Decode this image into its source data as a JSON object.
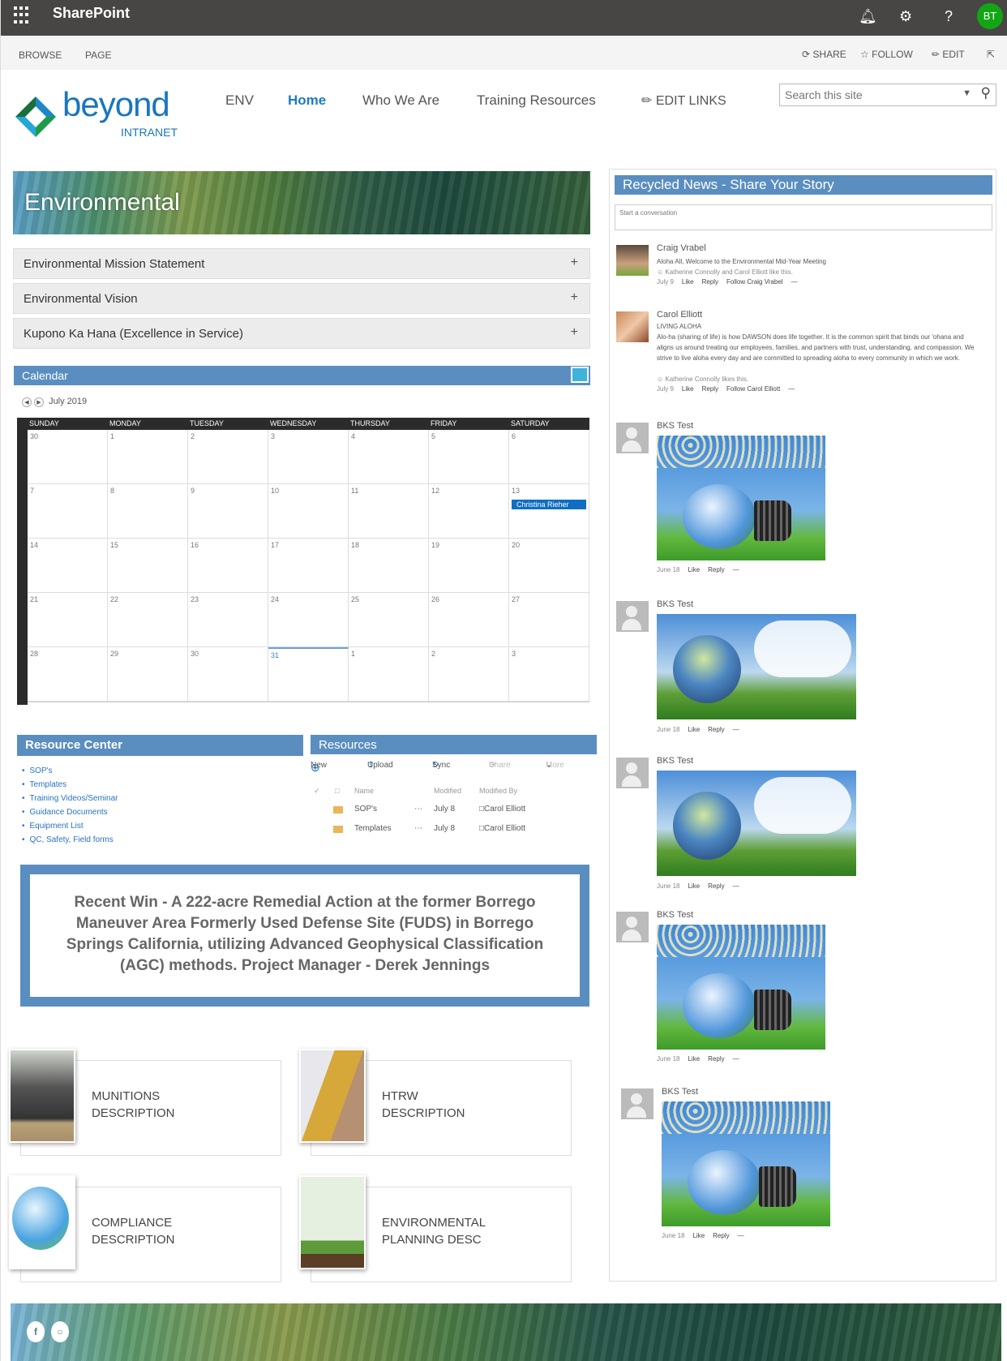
{
  "suite": {
    "brand": "SharePoint",
    "avatar_initials": "BT",
    "avatar_color": "#12a614"
  },
  "ribbon": {
    "tabs": [
      "BROWSE",
      "PAGE"
    ],
    "actions": {
      "share": "SHARE",
      "follow": "FOLLOW",
      "edit": "EDIT"
    }
  },
  "logo": {
    "word": "beyond",
    "sub": "INTRANET"
  },
  "nav": {
    "items": [
      "ENV",
      "Home",
      "Who We Are",
      "Training Resources"
    ],
    "active": "Home",
    "edit_links": "EDIT LINKS"
  },
  "search": {
    "placeholder": "Search this site"
  },
  "hero": {
    "title": "Environmental"
  },
  "accordion": [
    "Environmental Mission Statement",
    "Environmental Vision",
    "Kupono Ka Hana (Excellence in Service)"
  ],
  "calendar": {
    "title": "Calendar",
    "month": "July 2019",
    "days": [
      "SUNDAY",
      "MONDAY",
      "TUESDAY",
      "WEDNESDAY",
      "THURSDAY",
      "FRIDAY",
      "SATURDAY"
    ],
    "weeks": [
      [
        "30",
        "1",
        "2",
        "3",
        "4",
        "5",
        "6"
      ],
      [
        "7",
        "8",
        "9",
        "10",
        "11",
        "12",
        "13"
      ],
      [
        "14",
        "15",
        "16",
        "17",
        "18",
        "19",
        "20"
      ],
      [
        "21",
        "22",
        "23",
        "24",
        "25",
        "26",
        "27"
      ],
      [
        "28",
        "29",
        "30",
        "31",
        "1",
        "2",
        "3"
      ]
    ],
    "today": "31",
    "event": {
      "date": "13",
      "label": "Christina Rieher"
    }
  },
  "resource_center": {
    "title": "Resource Center",
    "links": [
      "SOP's",
      "Templates",
      "Training Videos/Seminar",
      "Guidance Documents",
      "Equipment List",
      "QC, Safety, Field forms"
    ]
  },
  "resources": {
    "title": "Resources",
    "toolbar": {
      "new": "New",
      "upload": "Upload",
      "sync": "Sync",
      "share": "Share",
      "more": "More"
    },
    "columns": {
      "name": "Name",
      "modified": "Modified",
      "modified_by": "Modified By"
    },
    "rows": [
      {
        "name": "SOP's",
        "modified": "July 8",
        "modified_by": "Carol Elliott"
      },
      {
        "name": "Templates",
        "modified": "July 8",
        "modified_by": "Carol Elliott"
      }
    ]
  },
  "recent_win": "Recent Win - A 222-acre Remedial Action at the former Borrego Maneuver Area Formerly Used Defense Site (FUDS) in Borrego Springs California, utilizing Advanced Geophysical Classification (AGC) methods. Project Manager - Derek Jennings",
  "tiles": [
    {
      "line1": "MUNITIONS",
      "line2": "DESCRIPTION"
    },
    {
      "line1": "HTRW",
      "line2": "DESCRIPTION"
    },
    {
      "line1": "COMPLIANCE",
      "line2": "DESCRIPTION"
    },
    {
      "line1": "ENVIRONMENTAL",
      "line2": "PLANNING DESC"
    }
  ],
  "feed": {
    "title": "Recycled News - Share Your Story",
    "placeholder": "Start a conversation",
    "posts": [
      {
        "author": "Craig Vrabel",
        "text": "Aloha All, Welcome to the Environmental Mid-Year Meeting",
        "likes": "Katherine Connolly and Carol Elliott like this.",
        "date": "July 9",
        "like": "Like",
        "reply": "Reply",
        "follow": "Follow Craig Vrabel",
        "more": "—"
      },
      {
        "author": "Carol Elliott",
        "subtitle": "LIVING ALOHA",
        "text": "Alo-ha (sharing of life) is how DAWSON does life together. It is the common spirit that binds our 'ohana and aligns us around treating our employees, families, and partners with trust, understanding, and compassion. We strive to live aloha every day and are committed to spreading aloha to every community in which we work.",
        "likes": "Katherine Connolly likes this.",
        "date": "July 9",
        "like": "Like",
        "reply": "Reply",
        "follow": "Follow Carol Elliott",
        "more": "—"
      },
      {
        "author": "BKS Test",
        "image": "lightbulb",
        "date": "June 18",
        "like": "Like",
        "reply": "Reply",
        "more": "—"
      },
      {
        "author": "BKS Test",
        "image": "earth",
        "date": "June 18",
        "like": "Like",
        "reply": "Reply",
        "more": "—"
      },
      {
        "author": "BKS Test",
        "image": "earth",
        "date": "June 18",
        "like": "Like",
        "reply": "Reply",
        "more": "—"
      },
      {
        "author": "BKS Test",
        "image": "lightbulb",
        "date": "June 18",
        "like": "Like",
        "reply": "Reply",
        "more": "—"
      },
      {
        "author": "BKS Test",
        "image": "lightbulb",
        "date": "June 18",
        "like": "Like",
        "reply": "Reply",
        "more": "—"
      }
    ]
  },
  "footer": {
    "social": [
      "facebook",
      "instagram"
    ]
  },
  "colors": {
    "accent": "#5a8ec0",
    "suitebar": "#484644",
    "link": "#2a72c4",
    "event": "#0f6dc4"
  }
}
